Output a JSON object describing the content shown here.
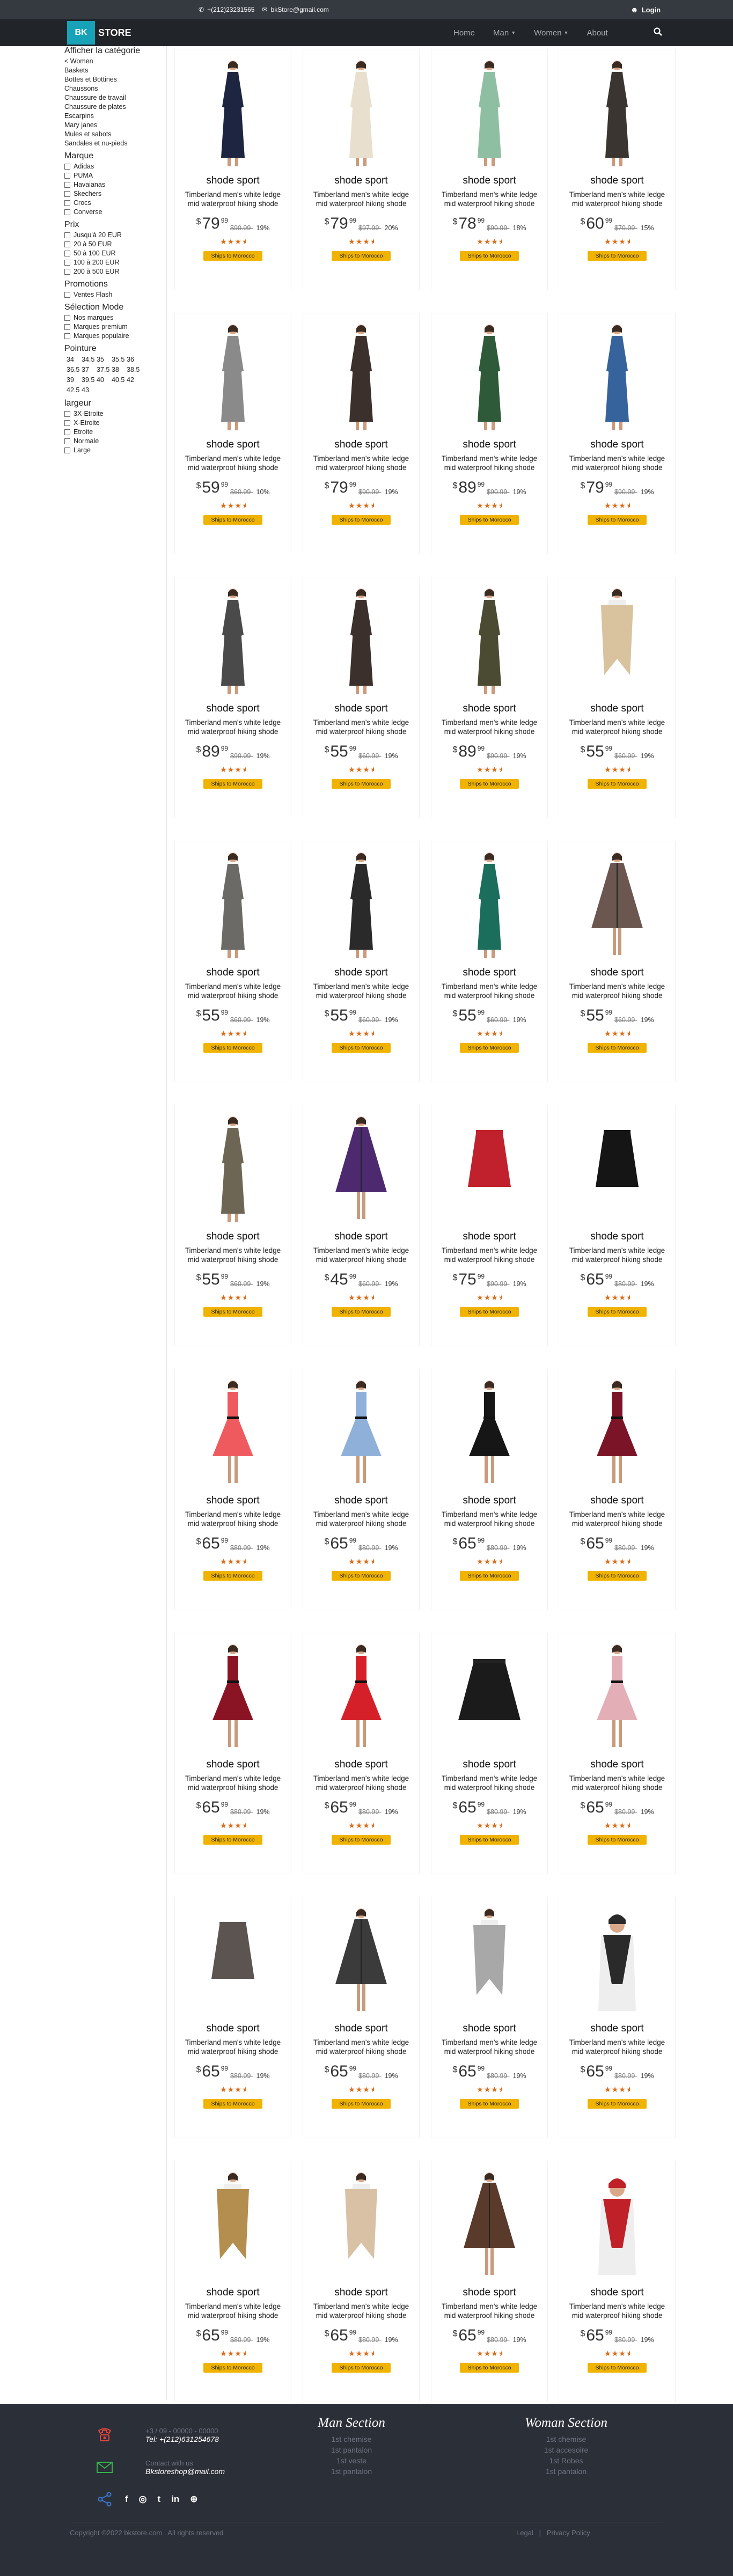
{
  "topbar": {
    "phone": "+(212)23231565",
    "email": "bkStore@gmail.com",
    "login": "Login"
  },
  "navbar": {
    "logo_bk": "BK",
    "logo_store": "STORE",
    "links": [
      "Home",
      "Man",
      "Women",
      "About"
    ]
  },
  "sidebar": {
    "category_title": "Afficher la catégorie",
    "category_parent": "< Women",
    "categories": [
      "Baskets",
      "Bottes et Bottines",
      "Chaussons",
      "Chaussure de travail",
      "Chaussure de plates",
      "Escarpins",
      "Mary janes",
      "Mules et sabots",
      "Sandales et nu-pieds"
    ],
    "brand_title": "Marque",
    "brands": [
      "Adidas",
      "PUMA",
      "Havaianas",
      "Skechers",
      "Crocs",
      "Converse"
    ],
    "price_title": "Prix",
    "prices": [
      "Jusqu'à 20 EUR",
      "20 à 50 EUR",
      "50 à 100 EUR",
      "100 à 200 EUR",
      "200 à 500 EUR"
    ],
    "promo_title": "Promotions",
    "promos": [
      "Ventes Flash"
    ],
    "mode_title": "Sélection Mode",
    "modes": [
      "Nos marques",
      "Marques premium",
      "Marques populaire"
    ],
    "size_title": "Pointure",
    "sizes": [
      "34",
      "34.5",
      "35",
      "35.5",
      "36",
      "36.5",
      "37",
      "37.5",
      "38",
      "38.5",
      "39",
      "39.5",
      "40",
      "40.5",
      "42",
      "42.5",
      "43"
    ],
    "width_title": "largeur",
    "widths": [
      "3X-Etroite",
      "X-Etroite",
      "Etroite",
      "Normale",
      "Large"
    ]
  },
  "product_common": {
    "brand": "shode sport",
    "desc": "Timberland men's white ledge mid waterproof hiking shode",
    "currency": "$",
    "cents": "99",
    "ship": "Ships to Morocco",
    "rating": "3.5 of 5 stars"
  },
  "products": [
    {
      "price": "79",
      "old": "$90.99-",
      "disc": "19%",
      "garment": "navy-dress"
    },
    {
      "price": "79",
      "old": "$97.99-",
      "disc": "20%",
      "garment": "floral-dress"
    },
    {
      "price": "78",
      "old": "$90.99-",
      "disc": "18%",
      "garment": "mint-dress"
    },
    {
      "price": "60",
      "old": "$70.99-",
      "disc": "15%",
      "garment": "dark-print-dress"
    },
    {
      "price": "59",
      "old": "$60.99-",
      "disc": "10%",
      "garment": "grey-shirt-dress"
    },
    {
      "price": "79",
      "old": "$90.99-",
      "disc": "19%",
      "garment": "dark-floral-dress"
    },
    {
      "price": "89",
      "old": "$90.99-",
      "disc": "19%",
      "garment": "green-floral-dress"
    },
    {
      "price": "79",
      "old": "$90.99-",
      "disc": "19%",
      "garment": "denim-dress"
    },
    {
      "price": "89",
      "old": "$90.99-",
      "disc": "19%",
      "garment": "grey-swing-dress"
    },
    {
      "price": "55",
      "old": "$60.99-",
      "disc": "19%",
      "garment": "dark-floral-dress"
    },
    {
      "price": "89",
      "old": "$90.99-",
      "disc": "19%",
      "garment": "olive-floral-dress"
    },
    {
      "price": "55",
      "old": "$60.99-",
      "disc": "19%",
      "garment": "beige-shawl"
    },
    {
      "price": "55",
      "old": "$60.99-",
      "disc": "19%",
      "garment": "print-long-dress"
    },
    {
      "price": "55",
      "old": "$60.99-",
      "disc": "19%",
      "garment": "black-long-dress"
    },
    {
      "price": "55",
      "old": "$60.99-",
      "disc": "19%",
      "garment": "teal-dress"
    },
    {
      "price": "55",
      "old": "$60.99-",
      "disc": "19%",
      "garment": "plaid-poncho"
    },
    {
      "price": "55",
      "old": "$60.99-",
      "disc": "19%",
      "garment": "leopard-dress"
    },
    {
      "price": "45",
      "old": "$60.99-",
      "disc": "19%",
      "garment": "purple-poncho"
    },
    {
      "price": "75",
      "old": "$90.99-",
      "disc": "19%",
      "garment": "red-skirt"
    },
    {
      "price": "65",
      "old": "$80.99-",
      "disc": "19%",
      "garment": "black-skirt"
    },
    {
      "price": "65",
      "old": "$80.99-",
      "disc": "19%",
      "garment": "coral-swing-dress"
    },
    {
      "price": "65",
      "old": "$80.99-",
      "disc": "19%",
      "garment": "blue-swing-dress"
    },
    {
      "price": "65",
      "old": "$80.99-",
      "disc": "19%",
      "garment": "black-cocktail-dress"
    },
    {
      "price": "65",
      "old": "$80.99-",
      "disc": "19%",
      "garment": "burgundy-dress"
    },
    {
      "price": "65",
      "old": "$80.99-",
      "disc": "19%",
      "garment": "wine-dress"
    },
    {
      "price": "65",
      "old": "$80.99-",
      "disc": "19%",
      "garment": "red-black-dress"
    },
    {
      "price": "65",
      "old": "$80.99-",
      "disc": "19%",
      "garment": "black-tutu"
    },
    {
      "price": "65",
      "old": "$80.99-",
      "disc": "19%",
      "garment": "pink-dress"
    },
    {
      "price": "65",
      "old": "$80.99-",
      "disc": "19%",
      "garment": "print-skirt"
    },
    {
      "price": "65",
      "old": "$80.99-",
      "disc": "19%",
      "garment": "lace-kimono"
    },
    {
      "price": "65",
      "old": "$80.99-",
      "disc": "19%",
      "garment": "grey-scarf"
    },
    {
      "price": "65",
      "old": "$80.99-",
      "disc": "19%",
      "garment": "striped-hat-scarf"
    },
    {
      "price": "65",
      "old": "$80.99-",
      "disc": "19%",
      "garment": "gold-shawl"
    },
    {
      "price": "65",
      "old": "$80.99-",
      "disc": "19%",
      "garment": "cream-shawl"
    },
    {
      "price": "65",
      "old": "$80.99-",
      "disc": "19%",
      "garment": "brown-poncho"
    },
    {
      "price": "65",
      "old": "$80.99-",
      "disc": "19%",
      "garment": "red-plaid-scarf"
    }
  ],
  "footer": {
    "phone_l1": "+3 / 09 - 00000 - 00000",
    "phone_l2": "Tel: +(212)631254678",
    "mail_l1": "Contact with us",
    "mail_l2": "Bkstoreshop@mail.com",
    "man_title": "Man Section",
    "man_links": [
      "1st chemise",
      "1st pantalon",
      "1st veste",
      "1st pantalon"
    ],
    "woman_title": "Woman Section",
    "woman_links": [
      "1st chemise",
      "1st accesoire",
      "1st Robes",
      "1st pantalon"
    ],
    "socials": [
      "f",
      "◎",
      "t",
      "in",
      "⊕"
    ],
    "copyright": "Copyright ©2022 bkstore.com . All rights reserved",
    "legal": "Legal",
    "privacy": "Privacy Policy"
  },
  "colors": {
    "topbar": "#343a40",
    "navbar": "#212529",
    "logo": "#17a2b8",
    "ship_badge": "#f0b400",
    "stars": "#dc6b17",
    "footer": "#2b2f38"
  }
}
